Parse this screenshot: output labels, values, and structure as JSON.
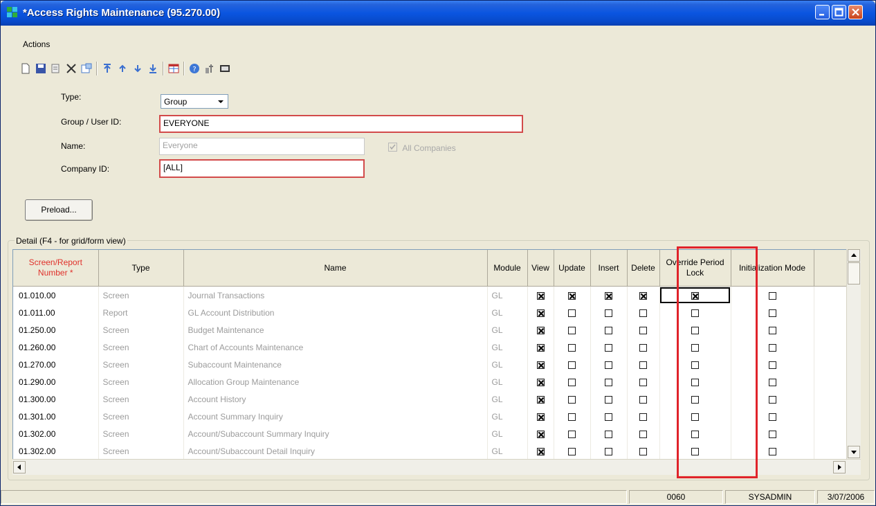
{
  "window": {
    "title": "*Access Rights Maintenance (95.270.00)"
  },
  "menu": {
    "actions": "Actions"
  },
  "toolbar": {
    "icons": [
      "new-icon",
      "save-icon",
      "copy-icon",
      "delete-icon",
      "cancel-icon",
      "first-icon",
      "prev-icon",
      "next-icon",
      "last-icon",
      "grid-icon",
      "help-icon",
      "customize-icon",
      "screen-icon"
    ]
  },
  "form": {
    "type_label": "Type:",
    "type_value": "Group",
    "group_label": "Group / User ID:",
    "group_value": "EVERYONE",
    "name_label": "Name:",
    "name_value": "Everyone",
    "all_companies_label": "All Companies",
    "company_label": "Company ID:",
    "company_value": "[ALL]",
    "preload_label": "Preload..."
  },
  "detail": {
    "group_label": "Detail (F4 - for grid/form view)",
    "columns": {
      "number": "Screen/Report Number *",
      "type": "Type",
      "name": "Name",
      "module": "Module",
      "view": "View",
      "update": "Update",
      "insert": "Insert",
      "delete": "Delete",
      "override": "Override Period Lock",
      "init": "Initialization Mode"
    },
    "rows": [
      {
        "num": "01.010.00",
        "type": "Screen",
        "name": "Journal Transactions",
        "module": "GL",
        "view": true,
        "update": true,
        "insert": true,
        "delete": true,
        "override": true,
        "init": false
      },
      {
        "num": "01.011.00",
        "type": "Report",
        "name": "GL Account Distribution",
        "module": "GL",
        "view": true,
        "update": false,
        "insert": false,
        "delete": false,
        "override": false,
        "init": false
      },
      {
        "num": "01.250.00",
        "type": "Screen",
        "name": "Budget Maintenance",
        "module": "GL",
        "view": true,
        "update": false,
        "insert": false,
        "delete": false,
        "override": false,
        "init": false
      },
      {
        "num": "01.260.00",
        "type": "Screen",
        "name": "Chart of Accounts Maintenance",
        "module": "GL",
        "view": true,
        "update": false,
        "insert": false,
        "delete": false,
        "override": false,
        "init": false
      },
      {
        "num": "01.270.00",
        "type": "Screen",
        "name": "Subaccount Maintenance",
        "module": "GL",
        "view": true,
        "update": false,
        "insert": false,
        "delete": false,
        "override": false,
        "init": false
      },
      {
        "num": "01.290.00",
        "type": "Screen",
        "name": "Allocation Group Maintenance",
        "module": "GL",
        "view": true,
        "update": false,
        "insert": false,
        "delete": false,
        "override": false,
        "init": false
      },
      {
        "num": "01.300.00",
        "type": "Screen",
        "name": "Account History",
        "module": "GL",
        "view": true,
        "update": false,
        "insert": false,
        "delete": false,
        "override": false,
        "init": false
      },
      {
        "num": "01.301.00",
        "type": "Screen",
        "name": "Account Summary Inquiry",
        "module": "GL",
        "view": true,
        "update": false,
        "insert": false,
        "delete": false,
        "override": false,
        "init": false
      },
      {
        "num": "01.302.00",
        "type": "Screen",
        "name": "Account/Subaccount Summary Inquiry",
        "module": "GL",
        "view": true,
        "update": false,
        "insert": false,
        "delete": false,
        "override": false,
        "init": false
      },
      {
        "num": "01.302.00",
        "type": "Screen",
        "name": "Account/Subaccount Detail Inquiry",
        "module": "GL",
        "view": true,
        "update": false,
        "insert": false,
        "delete": false,
        "override": false,
        "init": false
      }
    ]
  },
  "status": {
    "code": "0060",
    "user": "SYSADMIN",
    "date": "3/07/2006"
  }
}
